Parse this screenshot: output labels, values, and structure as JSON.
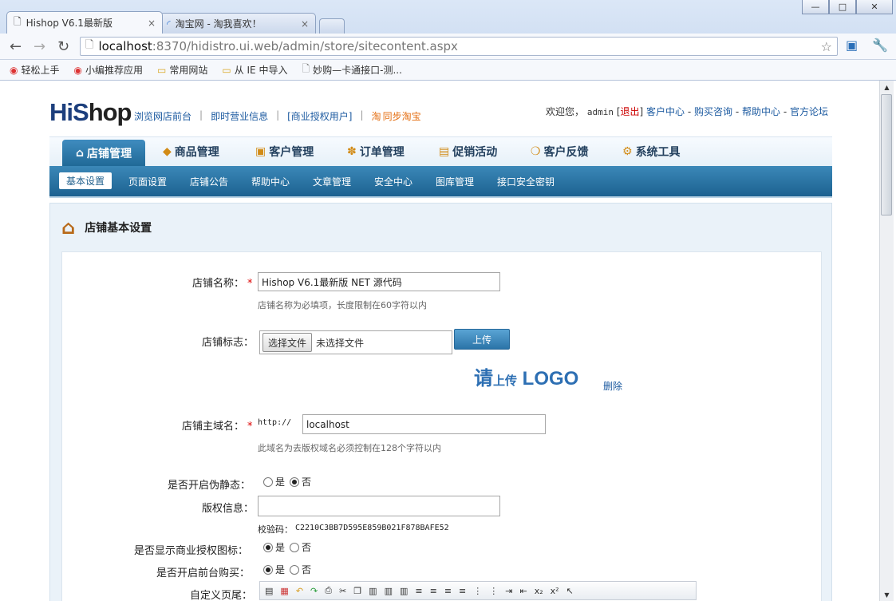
{
  "browser": {
    "tabs": [
      {
        "title": "Hishop V6.1最新版",
        "icon": "page-icon"
      },
      {
        "title": "淘宝网 - 淘我喜欢！",
        "icon": "loading-icon"
      }
    ],
    "close_glyph": "×",
    "url_host": "localhost",
    "url_path": ":8370/hidistro.ui.web/admin/store/sitecontent.aspx",
    "window_buttons": [
      "—",
      "□",
      "✕"
    ],
    "bookmarks": [
      {
        "label": "轻松上手",
        "icon": "chrome-icon"
      },
      {
        "label": "小编推荐应用",
        "icon": "chrome-icon"
      },
      {
        "label": "常用网站",
        "icon": "folder-icon"
      },
      {
        "label": "从 IE 中导入",
        "icon": "folder-icon"
      },
      {
        "label": "妙购—卡通接口-测...",
        "icon": "page-icon"
      }
    ]
  },
  "header": {
    "logo_prefix": "Hi",
    "logo_mid": "S",
    "logo_suffix": "hop",
    "links": [
      "浏览网店前台",
      "即时营业信息",
      "[商业授权用户]",
      "同步淘宝"
    ],
    "welcome": "欢迎您，",
    "user": "admin",
    "logout": "退出",
    "user_links": [
      "客户中心",
      "购买咨询",
      "帮助中心",
      "官方论坛"
    ]
  },
  "main_nav": [
    {
      "label": "店铺管理",
      "icon": "home-icon"
    },
    {
      "label": "商品管理",
      "icon": "box-icon"
    },
    {
      "label": "客户管理",
      "icon": "contact-icon"
    },
    {
      "label": "订单管理",
      "icon": "order-icon"
    },
    {
      "label": "促销活动",
      "icon": "promotion-icon"
    },
    {
      "label": "客户反馈",
      "icon": "feedback-icon"
    },
    {
      "label": "系统工具",
      "icon": "gear-icon"
    }
  ],
  "sub_nav": [
    "基本设置",
    "页面设置",
    "店铺公告",
    "帮助中心",
    "文章管理",
    "安全中心",
    "图库管理",
    "接口安全密钥"
  ],
  "panel": {
    "title": "店铺基本设置"
  },
  "form": {
    "store_name_label": "店铺名称：",
    "store_name_value": "Hishop V6.1最新版 NET 源代码",
    "store_name_hint": "店铺名称为必填项，长度限制在60字符以内",
    "logo_label": "店铺标志：",
    "file_button": "选择文件",
    "file_status": "未选择文件",
    "upload_button": "上传",
    "logo_placeholder_1": "请",
    "logo_placeholder_2": "上传",
    "logo_placeholder_3": " LOGO",
    "delete_link": "删除",
    "domain_label": "店铺主域名：",
    "domain_prefix": "http://",
    "domain_value": "localhost",
    "domain_hint": "此域名为去版权域名必须控制在128个字符以内",
    "rewrite_label": "是否开启伪静态：",
    "rewrite_yes": "是",
    "rewrite_no": "否",
    "rewrite_selected": "no",
    "copyright_label": "版权信息：",
    "copyright_value": "",
    "checksum_label": "校验码：",
    "checksum_value": "C2210C3BB7D595E859B021F878BAFE52",
    "license_icon_label": "是否显示商业授权图标：",
    "license_yes": "是",
    "license_no": "否",
    "frontend_buy_label": "是否开启前台购买：",
    "buy_yes": "是",
    "buy_no": "否",
    "footer_label": "自定义页尾："
  },
  "colors": {
    "nav_blue": "#1f6896",
    "link_blue": "#1c5aa0",
    "required_red": "#dd0000"
  }
}
